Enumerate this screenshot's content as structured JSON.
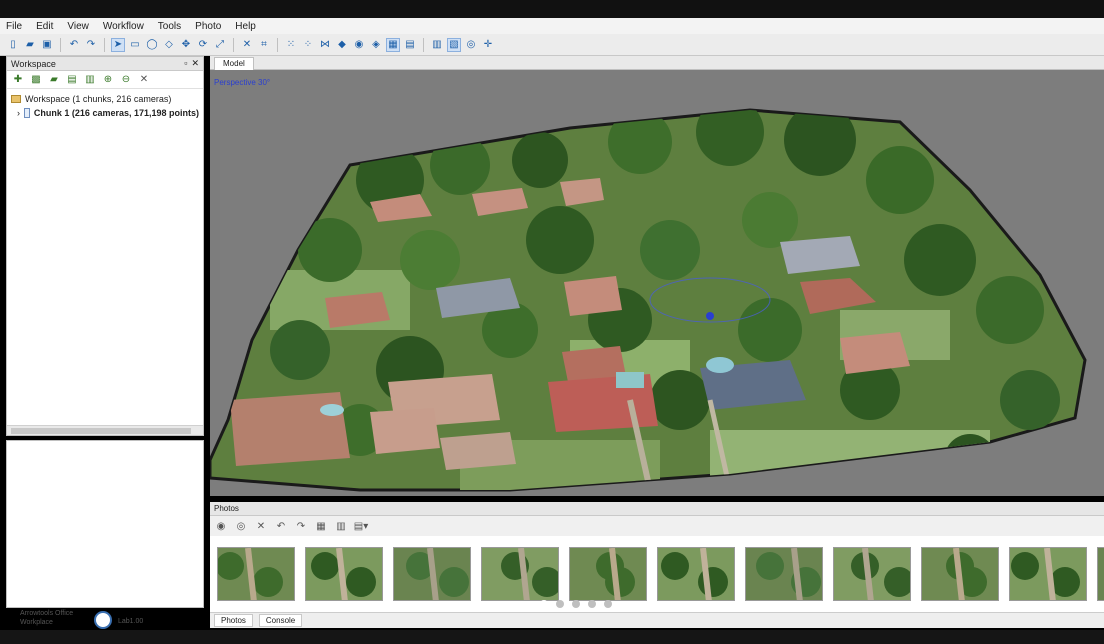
{
  "menu": [
    "File",
    "Edit",
    "View",
    "Workflow",
    "Tools",
    "Photo",
    "Help"
  ],
  "workspace": {
    "title": "Workspace",
    "root_label": "Workspace (1 chunks, 216 cameras)",
    "chunk_label": "Chunk 1 (216 cameras, 171,198 points)"
  },
  "model": {
    "tab": "Model",
    "perspective": "Perspective 30°"
  },
  "photos": {
    "title": "Photos",
    "bottom_tabs": [
      "Photos",
      "Console"
    ],
    "thumbnail_count": 11
  },
  "status": {
    "left_line1": "Arrowtools Office",
    "left_line2": "Workplace",
    "left_line3": "Lab1.00"
  },
  "colors": {
    "accent": "#1d5fa8",
    "viewport_bg": "#7d7d7d",
    "foliage": "#3e6b2c",
    "lawn": "#7fa15b",
    "roof": "#b46f5f"
  }
}
